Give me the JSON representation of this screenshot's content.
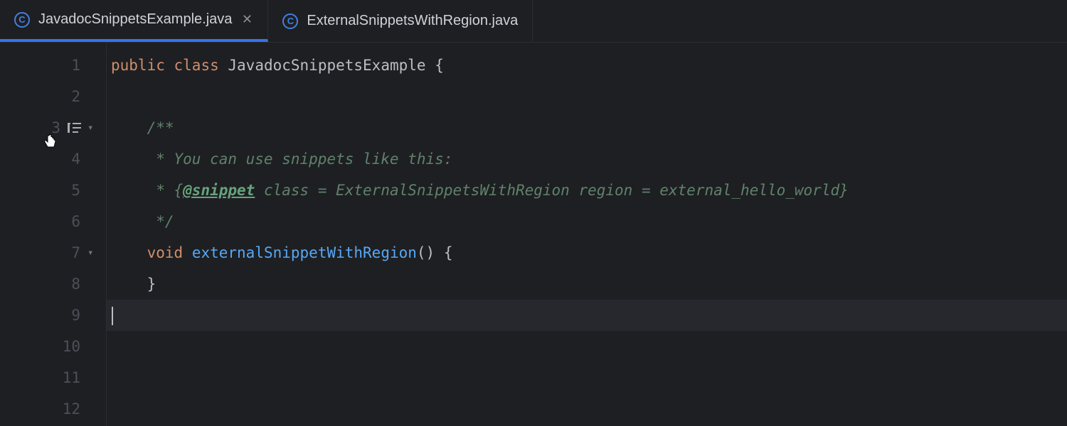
{
  "tabs": [
    {
      "label": "JavadocSnippetsExample.java",
      "active": true,
      "closeable": true
    },
    {
      "label": "ExternalSnippetsWithRegion.java",
      "active": false,
      "closeable": false
    }
  ],
  "gutter": {
    "lines": [
      "1",
      "2",
      "3",
      "4",
      "5",
      "6",
      "7",
      "8",
      "9",
      "10",
      "11",
      "12"
    ],
    "fold_at": [
      3,
      7
    ],
    "render_icon_at": 3,
    "current_line": 9
  },
  "code": {
    "l1": {
      "kw1": "public",
      "kw2": "class",
      "cls": "JavadocSnippetsExample",
      "brace": " {"
    },
    "l2": "",
    "l3": "    /**",
    "l4": "     * You can use snippets like this:",
    "l5": {
      "pre": "     * {",
      "tag": "@snippet",
      "rest": " class = ExternalSnippetsWithRegion region = external_hello_world}"
    },
    "l6": "     */",
    "l7": {
      "indent": "    ",
      "kw": "void",
      "mth": "externalSnippetWithRegion",
      "rest": "() {"
    },
    "l8": "    }",
    "l9": ""
  }
}
